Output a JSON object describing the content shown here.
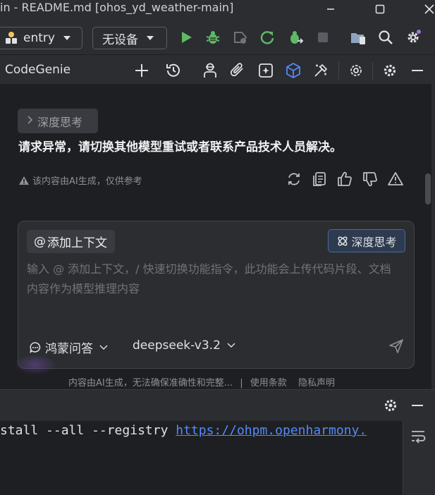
{
  "window": {
    "title": "in - README.md [ohos_yd_weather-main]"
  },
  "toolbar": {
    "run_config": "entry",
    "device": "无设备"
  },
  "panel": {
    "name": "CodeGenie"
  },
  "chat": {
    "thinking_chip": "深度思考",
    "error_message": "请求异常，请切换其他模型重试或者联系产品技术人员解决。",
    "ai_note": "该内容由AI生成，仅供参考"
  },
  "input": {
    "add_context": "添加上下文",
    "add_context_prefix": "@",
    "deep_think": "深度思考",
    "placeholder": "输入 @ 添加上下文，/ 快速切换功能指令，此功能会上传代码片段、文档内容作为模型推理内容",
    "mode": "鸿蒙问答",
    "model": "deepseek-v3.2"
  },
  "footer": {
    "disclaimer": "内容由AI生成，无法确保准确性和完整...",
    "sep": "|",
    "terms": "使用条款",
    "privacy": "隐私声明"
  },
  "terminal": {
    "command": "stall --all --registry ",
    "link": "https://ohpm.openharmony."
  },
  "colors": {
    "accent_green": "#5fb865",
    "accent_blue": "#548af7",
    "warn_yellow": "#f2c55c",
    "purple_dot": "#a571e6"
  }
}
